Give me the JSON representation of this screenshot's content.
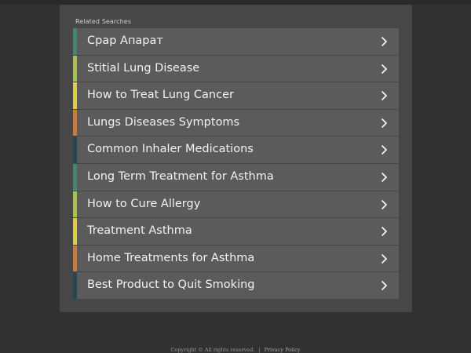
{
  "panel": {
    "heading": "Related Searches",
    "items": [
      {
        "label": "Срар Апарат",
        "accent": "#3b8a74"
      },
      {
        "label": "Stitial Lung Disease",
        "accent": "#a6c63d"
      },
      {
        "label": "How to Treat Lung Cancer",
        "accent": "#e3cf34"
      },
      {
        "label": "Lungs Diseases Symptoms",
        "accent": "#d6782a"
      },
      {
        "label": "Common Inhaler Medications",
        "accent": "#1f4a55"
      },
      {
        "label": "Long Term Treatment for Asthma",
        "accent": "#3b8a74"
      },
      {
        "label": "How to Cure Allergy",
        "accent": "#a6c63d"
      },
      {
        "label": "Treatment Asthma",
        "accent": "#e3cf34"
      },
      {
        "label": "Home Treatments for Asthma",
        "accent": "#d6782a"
      },
      {
        "label": "Best Product to Quit Smoking",
        "accent": "#1f4a55"
      }
    ],
    "chevron_icon": "chevron-right-icon"
  },
  "footer": {
    "copyright": "Copyright © All rights reserved.",
    "separator": "|",
    "privacy": "Privacy Policy"
  }
}
